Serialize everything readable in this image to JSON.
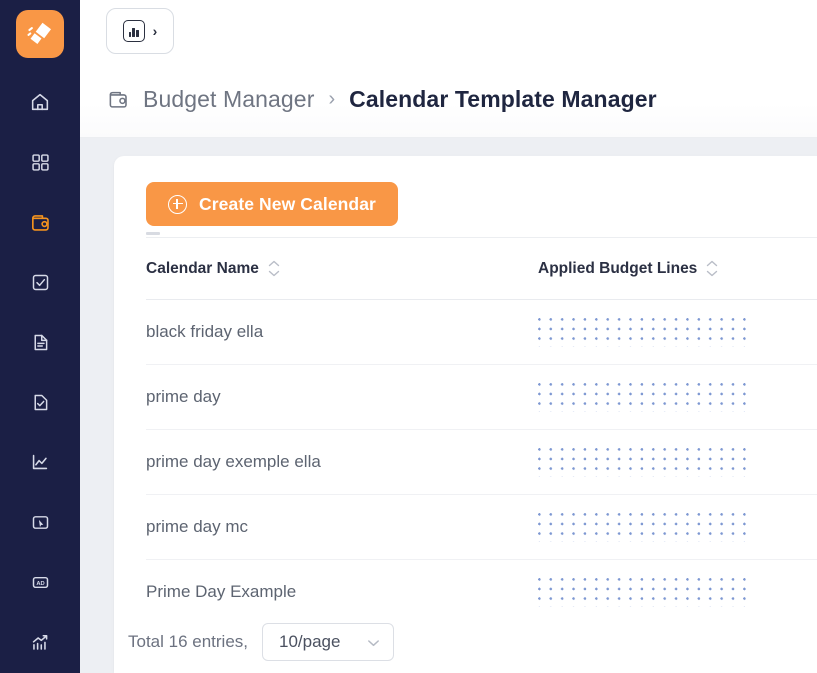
{
  "brand": {
    "logo_icon": "megaphone-logo-icon",
    "logo_color": "#f99746",
    "sidebar_color": "#1b1f45"
  },
  "sidebar": {
    "items": [
      {
        "name": "home",
        "icon": "home-icon",
        "active": false
      },
      {
        "name": "dashboard",
        "icon": "grid-icon",
        "active": false
      },
      {
        "name": "budget-manager",
        "icon": "wallet-icon",
        "active": true
      },
      {
        "name": "tasks",
        "icon": "checkbox-square-icon",
        "active": false
      },
      {
        "name": "reports",
        "icon": "document-icon",
        "active": false
      },
      {
        "name": "approvals",
        "icon": "document-check-icon",
        "active": false
      },
      {
        "name": "analytics",
        "icon": "line-chart-icon",
        "active": false
      },
      {
        "name": "campaigns",
        "icon": "cursor-box-icon",
        "active": false
      },
      {
        "name": "ads",
        "icon": "ad-icon",
        "active": false
      },
      {
        "name": "performance",
        "icon": "bar-chart-trend-icon",
        "active": false
      }
    ]
  },
  "topbar": {
    "workspace_button": {
      "icon": "bar-chart-icon",
      "chevron": "›"
    }
  },
  "breadcrumb": {
    "icon": "wallet-icon",
    "parent": "Budget Manager",
    "separator": "›",
    "current": "Calendar Template Manager"
  },
  "main": {
    "create_button": {
      "label": "Create New Calendar",
      "icon": "plus-circle-icon",
      "color": "#f99746"
    },
    "table": {
      "columns": [
        {
          "label": "Calendar Name",
          "sortable": true
        },
        {
          "label": "Applied Budget Lines",
          "sortable": true
        }
      ],
      "rows": [
        {
          "calendar_name": "black friday ella",
          "applied_budget_lines": "loading-placeholder"
        },
        {
          "calendar_name": "prime day",
          "applied_budget_lines": "loading-placeholder"
        },
        {
          "calendar_name": "prime day exemple ella",
          "applied_budget_lines": "loading-placeholder"
        },
        {
          "calendar_name": "prime day mc",
          "applied_budget_lines": "loading-placeholder"
        },
        {
          "calendar_name": "Prime Day Example",
          "applied_budget_lines": "loading-placeholder"
        }
      ]
    },
    "footer": {
      "total_text": "Total 16 entries,",
      "page_size": "10/page",
      "page_size_chevron": "⌄"
    }
  }
}
